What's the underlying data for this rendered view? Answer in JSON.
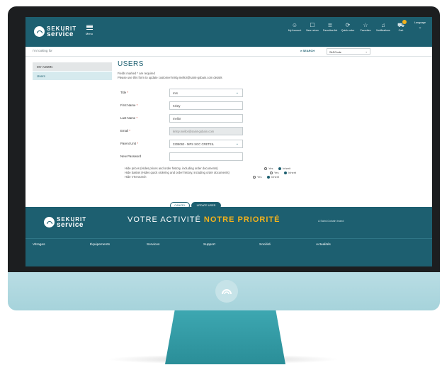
{
  "header": {
    "brand_top": "SEKURIT",
    "brand_bottom": "service",
    "menu_label": "Menu",
    "nav": [
      {
        "icon": "☺",
        "label": "My Account"
      },
      {
        "icon": "☐",
        "label": "New return"
      },
      {
        "icon": "≣",
        "label": "Favorites list"
      },
      {
        "icon": "⟳",
        "label": "Quick order"
      },
      {
        "icon": "☆",
        "label": "Favorites"
      },
      {
        "icon": "♫",
        "label": "Notifications"
      },
      {
        "icon": "⛟",
        "label": "Cart"
      },
      {
        "icon": "",
        "label": "Language"
      }
    ]
  },
  "search": {
    "placeholder": "I'm looking for",
    "button": "SEARCH",
    "select_value": "SkSCode"
  },
  "sidebar": {
    "items": [
      {
        "label": "MY ADMIN",
        "active": false
      },
      {
        "label": "Users",
        "active": true
      }
    ]
  },
  "main": {
    "title": "USERS",
    "note_required": "Fields marked * are required",
    "note_intro": "Please use this form to update customer kristy.mellor@saint-gobain.com details",
    "form": {
      "title_label": "Title",
      "title_value": "mrs",
      "first_name_label": "First Name",
      "first_name_value": "Kristy",
      "last_name_label": "Last Name",
      "last_name_value": "mellor",
      "email_label": "Email",
      "email_value": "kristy.mellor@saint-gobain.com",
      "parent_unit_label": "Parent Unit",
      "parent_unit_value": "3308063 - MPS SGC CRETEIL",
      "new_password_label": "New Password",
      "new_password_value": ""
    },
    "options": [
      {
        "label": "Hide prices (Hides prices and order history, including order documents)",
        "choice_a": "Yes",
        "choice_b": "Inherit",
        "selected": "b"
      },
      {
        "label": "Hide basket (Hides quick ordering and order history, including order documents)",
        "choice_a": "Yes",
        "choice_b": "Inherit",
        "selected": "b"
      },
      {
        "label": "Hide VIN search",
        "choice_a": "Yes",
        "choice_b": "Inherit",
        "selected": "b"
      }
    ],
    "cancel_label": "CANCEL",
    "update_label": "UPDATE USER"
  },
  "footer": {
    "brand_top": "SEKURIT",
    "brand_bottom": "service",
    "slogan_plain": "VOTRE ACTIVITÉ",
    "slogan_accent": "NOTRE PRIORITÉ",
    "brand_note": "A Saint-Gobain brand",
    "nav": [
      "Vitrages",
      "Équipements",
      "Services",
      "Support",
      "Société",
      "Actualités"
    ]
  },
  "colors": {
    "primary": "#1d5f70",
    "accent": "#f3b21b",
    "monitor_stand": "#2a8e98",
    "chin": "#a6d3db"
  }
}
